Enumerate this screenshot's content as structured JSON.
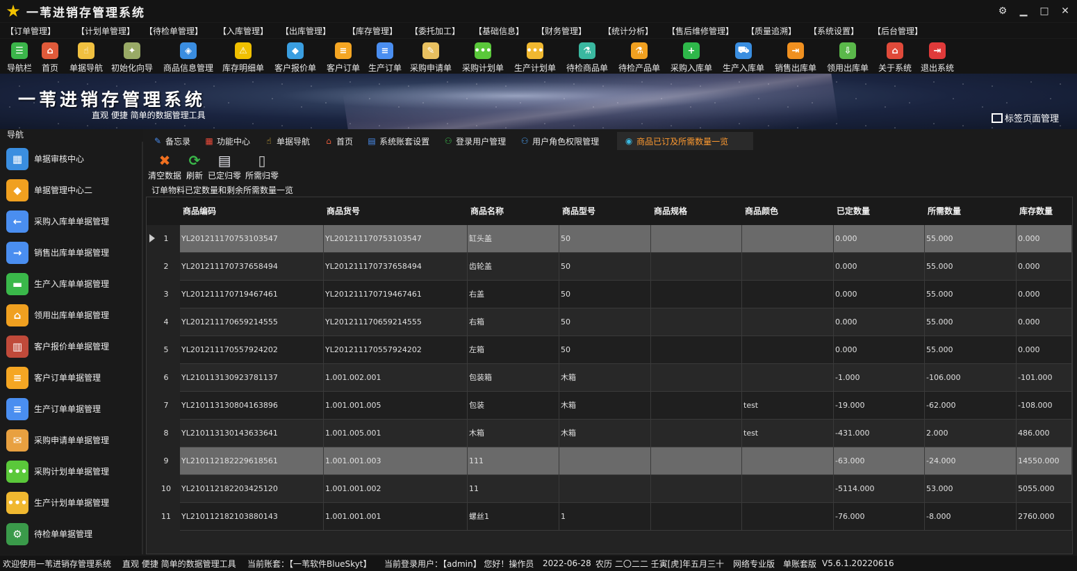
{
  "app": {
    "title": "一苇进销存管理系统"
  },
  "menu": [
    "【订单管理】",
    "【计划单管理】",
    "【待检单管理】",
    "【入库管理】",
    "【出库管理】",
    "【库存管理】",
    "【委托加工】",
    "【基础信息】",
    "【财务管理】",
    "【统计分析】",
    "【售后维修管理】",
    "【质量追溯】",
    "【系统设置】",
    "【后台管理】"
  ],
  "toolbar": [
    {
      "label": "导航栏",
      "icon": "menu-icon",
      "color": "#3bb54a"
    },
    {
      "label": "首页",
      "icon": "home-icon",
      "color": "#e05a3a"
    },
    {
      "label": "单据导航",
      "icon": "hand-icon",
      "color": "#f0c040"
    },
    {
      "label": "初始化向导",
      "icon": "wand-icon",
      "color": "#9a6"
    },
    {
      "label": "商品信息管理",
      "icon": "cubes-icon",
      "color": "#3a8de0"
    },
    {
      "label": "库存明细单",
      "icon": "warning-icon",
      "color": "#f0c000"
    },
    {
      "label": "客户报价单",
      "icon": "tag-icon",
      "color": "#3a9ee0"
    },
    {
      "label": "客户订单",
      "icon": "doc-orange-icon",
      "color": "#f5a623"
    },
    {
      "label": "生产订单",
      "icon": "doc-blue-icon",
      "color": "#4a8ef0"
    },
    {
      "label": "采购申请单",
      "icon": "note-icon",
      "color": "#e8c060"
    },
    {
      "label": "采购计划单",
      "icon": "chat-green-icon",
      "color": "#5ac83a"
    },
    {
      "label": "生产计划单",
      "icon": "chat-yellow-icon",
      "color": "#f0b830"
    },
    {
      "label": "待检商品单",
      "icon": "flask-icon",
      "color": "#3ab8a0"
    },
    {
      "label": "待检产品单",
      "icon": "beaker-icon",
      "color": "#f0a020"
    },
    {
      "label": "采购入库单",
      "icon": "plus-icon",
      "color": "#2eb84a"
    },
    {
      "label": "生产入库单",
      "icon": "cart-icon",
      "color": "#3a8ee0"
    },
    {
      "label": "销售出库单",
      "icon": "box-out-icon",
      "color": "#f09020"
    },
    {
      "label": "领用出库单",
      "icon": "download-icon",
      "color": "#5ab84a"
    },
    {
      "label": "关于系统",
      "icon": "house-icon",
      "color": "#e04a3a"
    },
    {
      "label": "退出系统",
      "icon": "exit-icon",
      "color": "#e03a3a"
    }
  ],
  "banner": {
    "title": "一苇进销存管理系统",
    "subtitle": "直观 便捷 简单的数据管理工具",
    "tag_manager": "标签页面管理"
  },
  "nav": {
    "header": "导航",
    "items": [
      {
        "label": "单据审核中心",
        "icon": "grid-icon",
        "color": "#3a8ee0"
      },
      {
        "label": "单据管理中心二",
        "icon": "grid-diamond-icon",
        "color": "#f0a020"
      },
      {
        "label": "采购入库单单据管理",
        "icon": "arrow-left-icon",
        "color": "#4a8ef0"
      },
      {
        "label": "销售出库单单据管理",
        "icon": "arrow-right-icon",
        "color": "#4a8ef0"
      },
      {
        "label": "生产入库单单据管理",
        "icon": "folder-green-icon",
        "color": "#3ab84a"
      },
      {
        "label": "领用出库单单据管理",
        "icon": "house-box-icon",
        "color": "#f0a020"
      },
      {
        "label": "客户报价单单据管理",
        "icon": "books-icon",
        "color": "#c04a3a"
      },
      {
        "label": "客户订单单据管理",
        "icon": "doc-orange-icon",
        "color": "#f5a623"
      },
      {
        "label": "生产订单单据管理",
        "icon": "doc-blue-icon",
        "color": "#4a8ef0"
      },
      {
        "label": "采购申请单单据管理",
        "icon": "envelope-icon",
        "color": "#e8a040"
      },
      {
        "label": "采购计划单单据管理",
        "icon": "chat-green-icon",
        "color": "#5ac83a"
      },
      {
        "label": "生产计划单单据管理",
        "icon": "chat-yellow-icon",
        "color": "#f0b830"
      },
      {
        "label": "待检单单据管理",
        "icon": "doc-green-icon",
        "color": "#3a9a4a"
      }
    ]
  },
  "tabs": [
    {
      "label": "备忘录",
      "icon": "memo-icon",
      "color": "#4a8ef0",
      "active": false
    },
    {
      "label": "功能中心",
      "icon": "grid4-icon",
      "color": "#e84a3a",
      "active": false
    },
    {
      "label": "单据导航",
      "icon": "hand-icon",
      "color": "#f0c040",
      "active": false
    },
    {
      "label": "首页",
      "icon": "home-icon",
      "color": "#e05a3a",
      "active": false
    },
    {
      "label": "系统账套设置",
      "icon": "server-icon",
      "color": "#4a8ef0",
      "active": false
    },
    {
      "label": "登录用户管理",
      "icon": "user-icon",
      "color": "#3ab84a",
      "active": false
    },
    {
      "label": "用户角色权限管理",
      "icon": "users-icon",
      "color": "#4a9ef0",
      "active": false
    },
    {
      "label": "商品已订及所需数量一览",
      "icon": "list-icon",
      "color": "#3ab8e0",
      "active": true
    }
  ],
  "subtoolbar": [
    {
      "label": "清空数据",
      "icon": "clear-icon",
      "color": "#f07020"
    },
    {
      "label": "刷新",
      "icon": "refresh-icon",
      "color": "#3ab84a"
    },
    {
      "label": "已定归零",
      "icon": "reset-ordered-icon",
      "color": "#e8e8f0"
    },
    {
      "label": "所需归零",
      "icon": "clipboard-icon",
      "color": "#cfcfcf"
    }
  ],
  "group_caption": "订单物料已定数量和剩余所需数量一览",
  "grid": {
    "columns": [
      "商品编码",
      "商品货号",
      "商品名称",
      "商品型号",
      "商品规格",
      "商品颜色",
      "已定数量",
      "所需数量",
      "库存数量"
    ],
    "rows": [
      {
        "n": "1",
        "code": "YL201211170753103547",
        "sku": "YL201211170753103547",
        "name": "缸头盖",
        "model": "50",
        "spec": "",
        "color": "",
        "ordered": "0.000",
        "required": "55.000",
        "stock": "0.000"
      },
      {
        "n": "2",
        "code": "YL201211170737658494",
        "sku": "YL201211170737658494",
        "name": "齿轮盖",
        "model": "50",
        "spec": "",
        "color": "",
        "ordered": "0.000",
        "required": "55.000",
        "stock": "0.000"
      },
      {
        "n": "3",
        "code": "YL201211170719467461",
        "sku": "YL201211170719467461",
        "name": "右盖",
        "model": "50",
        "spec": "",
        "color": "",
        "ordered": "0.000",
        "required": "55.000",
        "stock": "0.000"
      },
      {
        "n": "4",
        "code": "YL201211170659214555",
        "sku": "YL201211170659214555",
        "name": "右箱",
        "model": "50",
        "spec": "",
        "color": "",
        "ordered": "0.000",
        "required": "55.000",
        "stock": "0.000"
      },
      {
        "n": "5",
        "code": "YL201211170557924202",
        "sku": "YL201211170557924202",
        "name": "左箱",
        "model": "50",
        "spec": "",
        "color": "",
        "ordered": "0.000",
        "required": "55.000",
        "stock": "0.000"
      },
      {
        "n": "6",
        "code": "YL210113130923781137",
        "sku": "1.001.002.001",
        "name": "包装箱",
        "model": "木箱",
        "spec": "",
        "color": "",
        "ordered": "-1.000",
        "required": "-106.000",
        "stock": "-101.000"
      },
      {
        "n": "7",
        "code": "YL210113130804163896",
        "sku": "1.001.001.005",
        "name": "包装",
        "model": "木箱",
        "spec": "",
        "color": "test",
        "ordered": "-19.000",
        "required": "-62.000",
        "stock": "-108.000"
      },
      {
        "n": "8",
        "code": "YL210113130143633641",
        "sku": "1.001.005.001",
        "name": "木箱",
        "model": "木箱",
        "spec": "",
        "color": "test",
        "ordered": "-431.000",
        "required": "2.000",
        "stock": "486.000"
      },
      {
        "n": "9",
        "code": "YL210112182229618561",
        "sku": "1.001.001.003",
        "name": "111",
        "model": "",
        "spec": "",
        "color": "",
        "ordered": "-63.000",
        "required": "-24.000",
        "stock": "14550.000"
      },
      {
        "n": "10",
        "code": "YL210112182203425120",
        "sku": "1.001.001.002",
        "name": "11",
        "model": "",
        "spec": "",
        "color": "",
        "ordered": "-5114.000",
        "required": "53.000",
        "stock": "5055.000"
      },
      {
        "n": "11",
        "code": "YL210112182103880143",
        "sku": "1.001.001.001",
        "name": "螺丝1",
        "model": "1",
        "spec": "",
        "color": "",
        "ordered": "-76.000",
        "required": "-8.000",
        "stock": "2760.000"
      }
    ]
  },
  "status": {
    "welcome": "欢迎使用一苇进销存管理系统",
    "tagline": "直观 便捷 简单的数据管理工具",
    "account": "当前账套：【一苇软件BlueSkyt】",
    "user": "当前登录用户：【admin】 您好！操作员",
    "date": "2022-06-28",
    "lunar": "农历 二〇二二 壬寅[虎]年五月三十",
    "edition": "网络专业版",
    "mode": "单账套版",
    "version": "V5.6.1.20220616"
  }
}
